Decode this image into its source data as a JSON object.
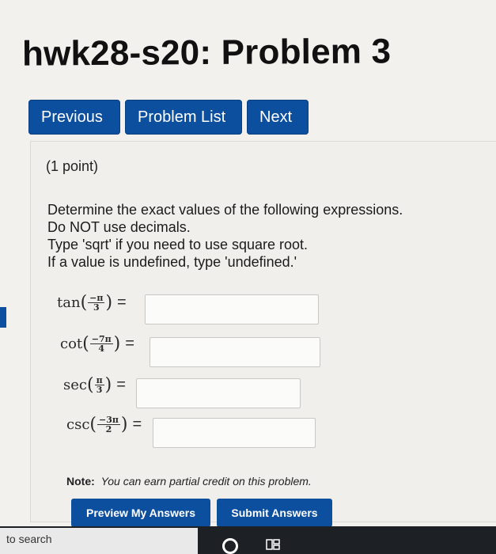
{
  "page": {
    "title": "hwk28-s20: Problem 3"
  },
  "nav": {
    "previous": "Previous",
    "problem_list": "Problem List",
    "next": "Next"
  },
  "problem": {
    "points": "(1 point)",
    "instructions": [
      "Determine the exact values of the following expressions.",
      "Do NOT use decimals.",
      "Type 'sqrt' if you need to use square root.",
      "If a value is undefined, type 'undefined.'"
    ],
    "expressions": [
      {
        "func": "tan",
        "num": "−π",
        "den": "3",
        "equals": "=",
        "answer": ""
      },
      {
        "func": "cot",
        "num": "−7π",
        "den": "4",
        "equals": "=",
        "answer": ""
      },
      {
        "func": "sec",
        "num": "π",
        "den": "3",
        "equals": "=",
        "answer": ""
      },
      {
        "func": "csc",
        "num": "−3π",
        "den": "2",
        "equals": "=",
        "answer": ""
      }
    ],
    "note_label": "Note:",
    "note_text": "You can earn partial credit on this problem."
  },
  "actions": {
    "preview": "Preview My Answers",
    "submit": "Submit Answers"
  },
  "taskbar": {
    "search_text": "to search"
  },
  "colors": {
    "button_blue": "#0d4f9f",
    "background": "#f3f1ee",
    "taskbar": "#1d2126"
  }
}
